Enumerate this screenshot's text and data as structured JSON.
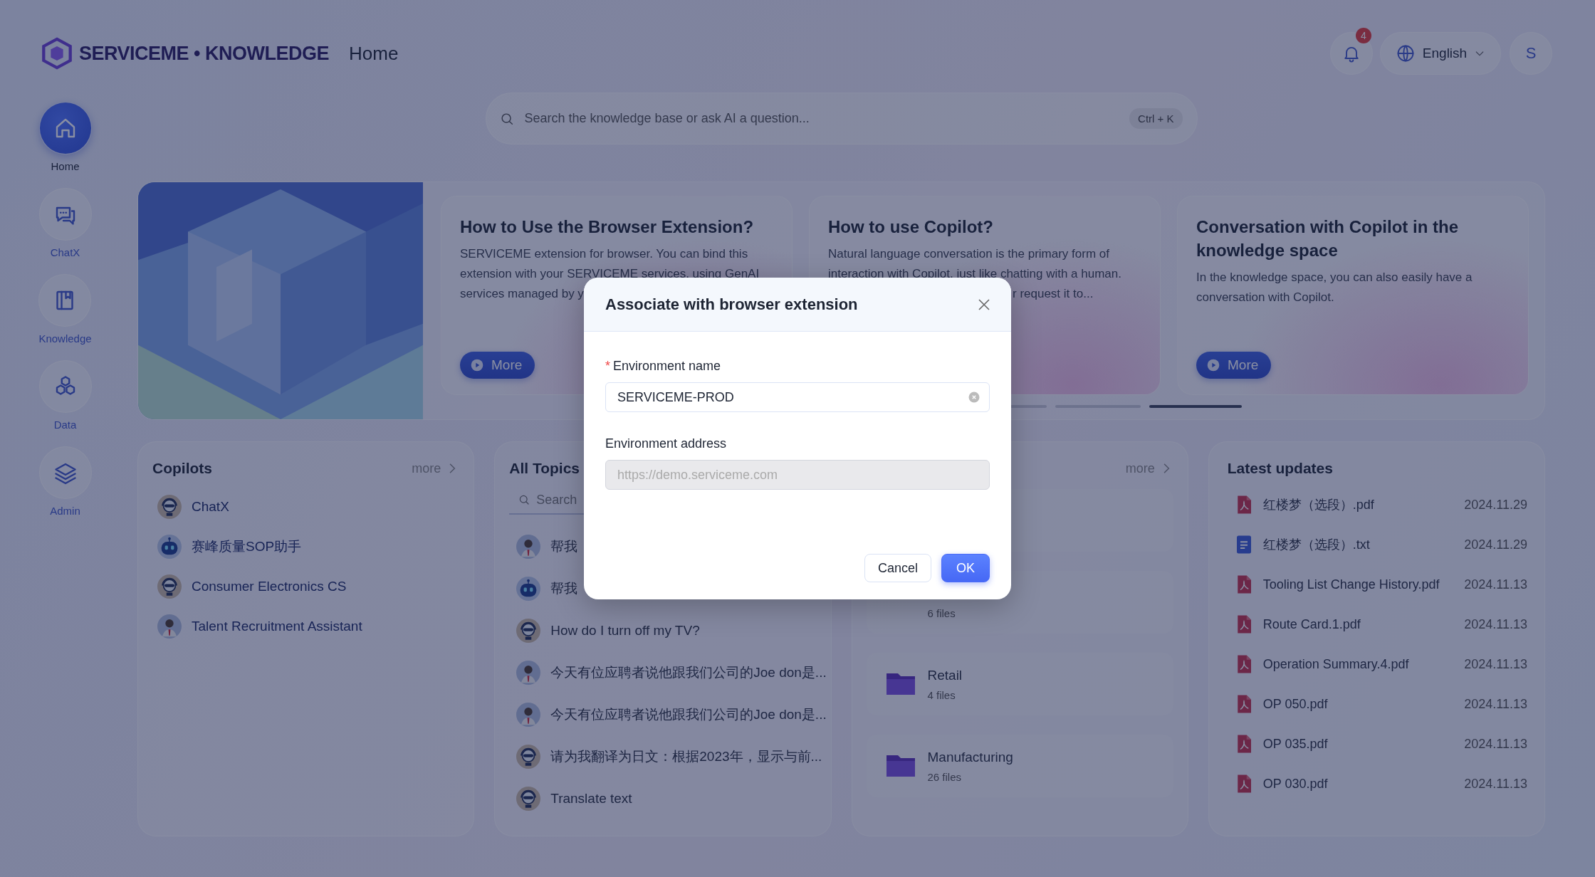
{
  "header": {
    "logo": "SERVICEME • KNOWLEDGE",
    "page_title": "Home",
    "notifications": "4",
    "language": "English",
    "avatar": "S"
  },
  "nav": [
    {
      "label": "Home",
      "selected": true
    },
    {
      "label": "ChatX",
      "selected": false
    },
    {
      "label": "Knowledge",
      "selected": false
    },
    {
      "label": "Data",
      "selected": false
    },
    {
      "label": "Admin",
      "selected": false
    }
  ],
  "search": {
    "placeholder": "Search the knowledge base or ask AI a question...",
    "shortcut": "Ctrl + K"
  },
  "carousel": {
    "cards": [
      {
        "title": "How to Use the Browser Extension?",
        "description": "SERVICEME extension for browser. You can bind this extension with your SERVICEME services, using GenAI services managed by y",
        "button": "More"
      },
      {
        "title": "How to use Copilot?",
        "description": "Natural language conversation is the primary form of interaction with Copilot, just like chatting with a human.",
        "tail": "r request it to..."
      },
      {
        "title": "Conversation with Copilot in the knowledge space",
        "description": "In the knowledge space, you can also easily have a conversation with Copilot.",
        "button": "More"
      }
    ],
    "pages": [
      {
        "selected": false
      },
      {
        "selected": false
      },
      {
        "selected": true
      }
    ]
  },
  "copilots": {
    "title": "Copilots",
    "more": "more",
    "items": [
      {
        "name": "ChatX"
      },
      {
        "name": "赛峰质量SOP助手"
      },
      {
        "name": "Consumer Electronics CS"
      },
      {
        "name": "Talent Recruitment Assistant"
      }
    ]
  },
  "topics": {
    "title": "All Topics",
    "search_placeholder": "Search",
    "items": [
      {
        "text": "帮我"
      },
      {
        "text": "帮我"
      },
      {
        "text": "How do I turn off my TV?"
      },
      {
        "text": "今天有位应聘者说他跟我们公司的Joe don是..."
      },
      {
        "text": "今天有位应聘者说他跟我们公司的Joe don是..."
      },
      {
        "text": "请为我翻译为日文：根据2023年，显示与前..."
      },
      {
        "text": "Translate text"
      }
    ]
  },
  "categories": {
    "more": "more",
    "items": [
      {
        "count": "6 files"
      },
      {
        "name": "Retail",
        "count": "4 files"
      },
      {
        "name": "Manufacturing",
        "count": "26 files"
      }
    ]
  },
  "updates": {
    "title": "Latest updates",
    "items": [
      {
        "name": "红楼梦（选段）.pdf",
        "kind": "pdf",
        "date": "2024.11.29"
      },
      {
        "name": "红楼梦（选段）.txt",
        "kind": "txt",
        "date": "2024.11.29"
      },
      {
        "name": "Tooling List Change History.pdf",
        "kind": "pdf",
        "date": "2024.11.13"
      },
      {
        "name": "Route Card.1.pdf",
        "kind": "pdf",
        "date": "2024.11.13"
      },
      {
        "name": "Operation Summary.4.pdf",
        "kind": "pdf",
        "date": "2024.11.13"
      },
      {
        "name": "OP 050.pdf",
        "kind": "pdf",
        "date": "2024.11.13"
      },
      {
        "name": "OP 035.pdf",
        "kind": "pdf",
        "date": "2024.11.13"
      },
      {
        "name": "OP 030.pdf",
        "kind": "pdf",
        "date": "2024.11.13"
      }
    ]
  },
  "dialog": {
    "title": "Associate with browser extension",
    "fields": [
      {
        "label": "Environment name",
        "required_mark": "*",
        "value": "SERVICEME-PROD",
        "disabled": false
      },
      {
        "label": "Environment address",
        "placeholder": "https://demo.serviceme.com",
        "disabled": true
      }
    ],
    "buttons": [
      {
        "label": "Cancel",
        "kind": "default"
      },
      {
        "label": "OK",
        "kind": "primary"
      }
    ]
  }
}
